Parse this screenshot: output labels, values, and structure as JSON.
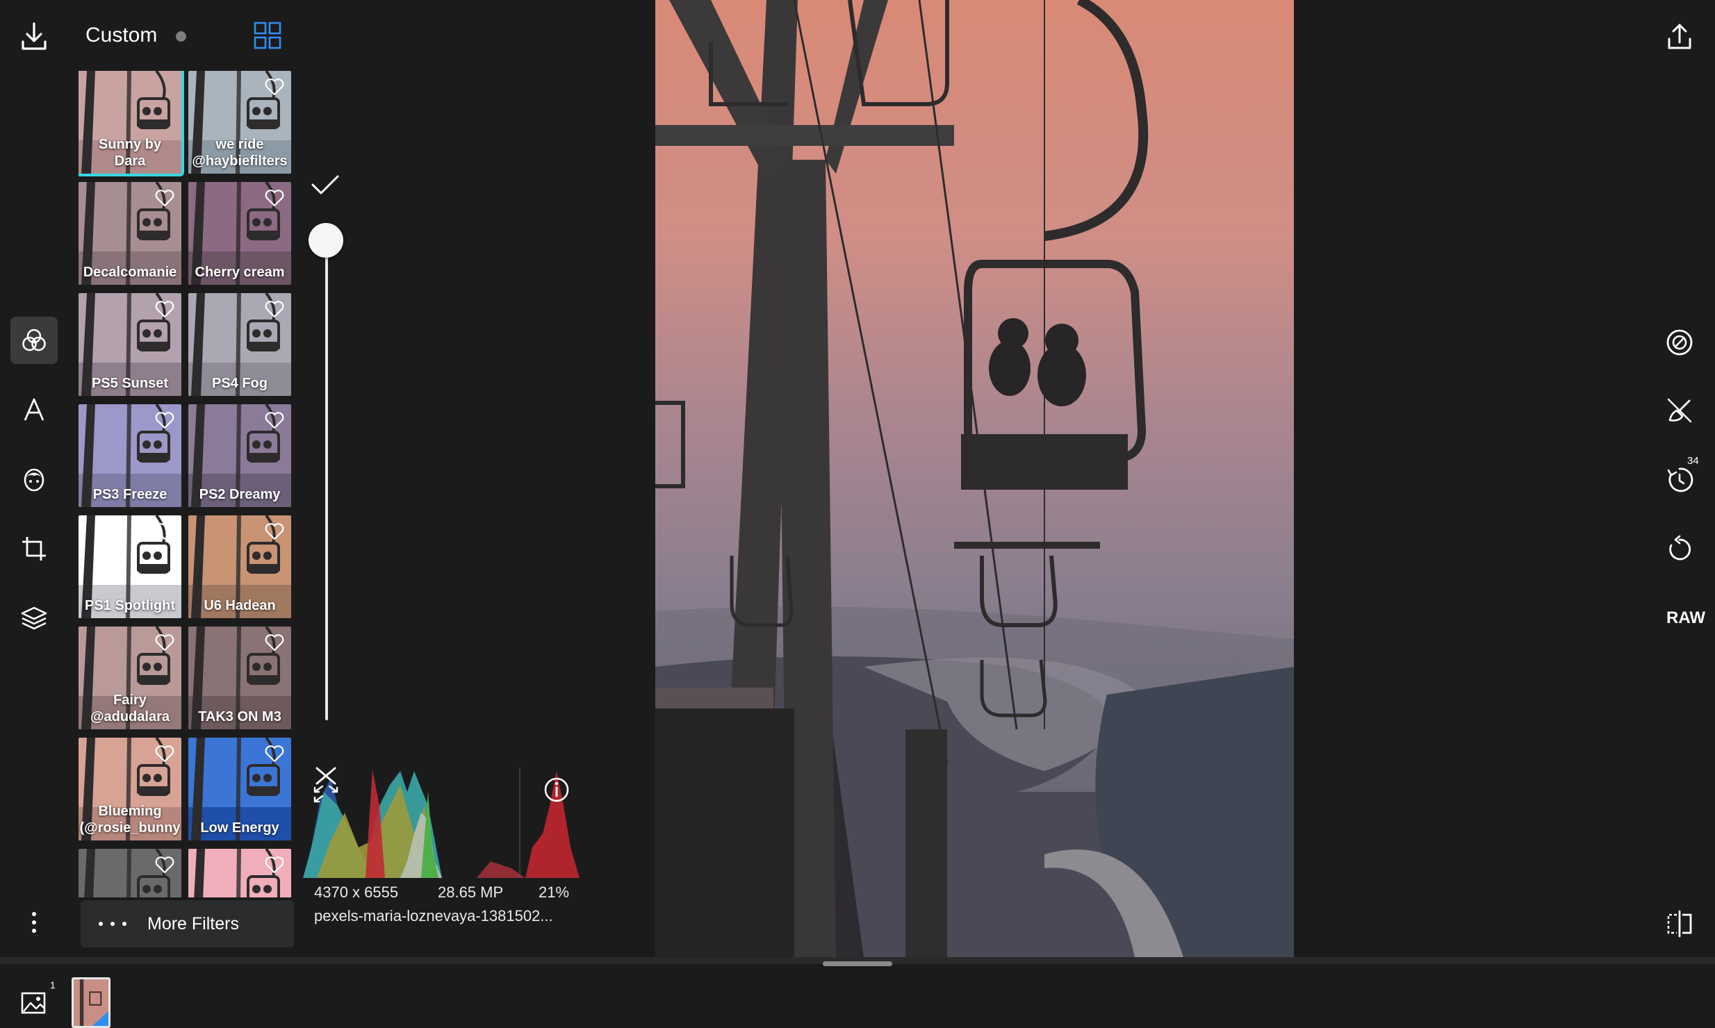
{
  "panel": {
    "title": "Custom",
    "has_unsaved_changes": true
  },
  "filters": [
    {
      "label": "Sunny by\nDara",
      "selected": true,
      "tint": "#b08a8a",
      "sky": "#c9a3a0"
    },
    {
      "label": "we ride\n@haybiefilters",
      "selected": false,
      "tint": "#8c9aa6",
      "sky": "#a9b4bd"
    },
    {
      "label": "Decalcomanie",
      "selected": false,
      "tint": "#8a7378",
      "sky": "#a78e93"
    },
    {
      "label": "Cherry cream",
      "selected": false,
      "tint": "#6d5566",
      "sky": "#8c6a83"
    },
    {
      "label": "PS5 Sunset",
      "selected": false,
      "tint": "#8f7f8c",
      "sky": "#b3a1ae"
    },
    {
      "label": "PS4 Fog",
      "selected": false,
      "tint": "#8f8c97",
      "sky": "#aba8b3"
    },
    {
      "label": "PS3 Freeze",
      "selected": false,
      "tint": "#7f7ca6",
      "sky": "#9c98c9"
    },
    {
      "label": "PS2 Dreamy",
      "selected": false,
      "tint": "#6c5f79",
      "sky": "#8b7b99"
    },
    {
      "label": "PS1 Spotlight",
      "selected": false,
      "tint": "#c9c9cf",
      "sky": "#ffffff"
    },
    {
      "label": "U6 Hadean",
      "selected": false,
      "tint": "#a07860",
      "sky": "#c89474"
    },
    {
      "label": "Fairy\n@adudalara",
      "selected": false,
      "tint": "#957878",
      "sky": "#b99a98"
    },
    {
      "label": "TAK3 ON M3",
      "selected": false,
      "tint": "#6e5a5c",
      "sky": "#8a7374"
    },
    {
      "label": "Blueming\n(@rosie_bunny",
      "selected": false,
      "tint": "#b6867c",
      "sky": "#d7a394"
    },
    {
      "label": "Low Energy",
      "selected": false,
      "tint": "#1f4fa8",
      "sky": "#3b76d6"
    },
    {
      "label": "",
      "selected": false,
      "tint": "#4a4a4c",
      "sky": "#6a6a6c"
    },
    {
      "label": "",
      "selected": false,
      "tint": "#d58c98",
      "sky": "#f0aebb"
    }
  ],
  "more_filters": {
    "label": "More Filters"
  },
  "strength": {
    "value": 1.0
  },
  "image_info": {
    "dimensions": "4370 x 6555",
    "megapixels": "28.65 MP",
    "zoom": "21%",
    "filename": "pexels-maria-loznevaya-1381502..."
  },
  "history": {
    "count": "34"
  },
  "raw_label": "RAW",
  "gallery": {
    "count": "1"
  },
  "icons": {
    "left_rail": [
      "download-icon",
      "filters-icon",
      "text-icon",
      "face-icon",
      "crop-icon",
      "layers-icon",
      "more-options-icon"
    ],
    "right_rail": [
      "export-icon",
      "auto-enhance-icon",
      "retouch-icon",
      "history-icon",
      "reset-icon",
      "compare-icon"
    ]
  },
  "colors": {
    "accent": "#37d7e0",
    "grid_toggle": "#2f8ff0",
    "background": "#1b1b1c"
  }
}
